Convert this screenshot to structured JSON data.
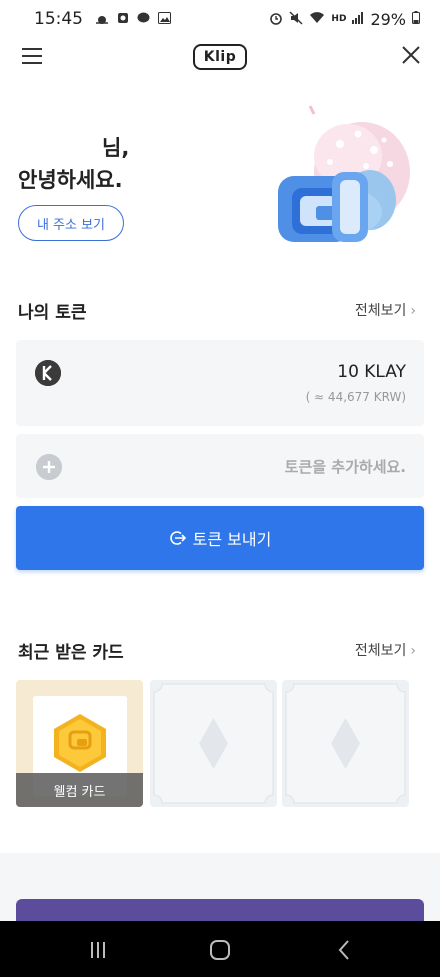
{
  "status_bar": {
    "time": "15:45",
    "battery": "29%",
    "network": "HD"
  },
  "header": {
    "logo_text": "Klip"
  },
  "greeting": {
    "name_suffix": "님,",
    "hello": "안녕하세요.",
    "address_button": "내 주소 보기"
  },
  "tokens": {
    "title": "나의 토큰",
    "view_all": "전체보기",
    "items": [
      {
        "symbol_icon": "klay-logo",
        "amount": "10 KLAY",
        "fiat": "( ≈ 44,677 KRW)"
      }
    ],
    "add_token": "토큰을 추가하세요.",
    "send_button": "토큰 보내기"
  },
  "cards": {
    "title": "최근 받은 카드",
    "view_all": "전체보기",
    "items": [
      {
        "label": "웰컴 카드"
      }
    ]
  },
  "colors": {
    "primary_blue": "#2f76ea",
    "outline_blue": "#3a6fd8",
    "card_bg": "#f5f6f8",
    "purple": "#5c4d9c"
  }
}
